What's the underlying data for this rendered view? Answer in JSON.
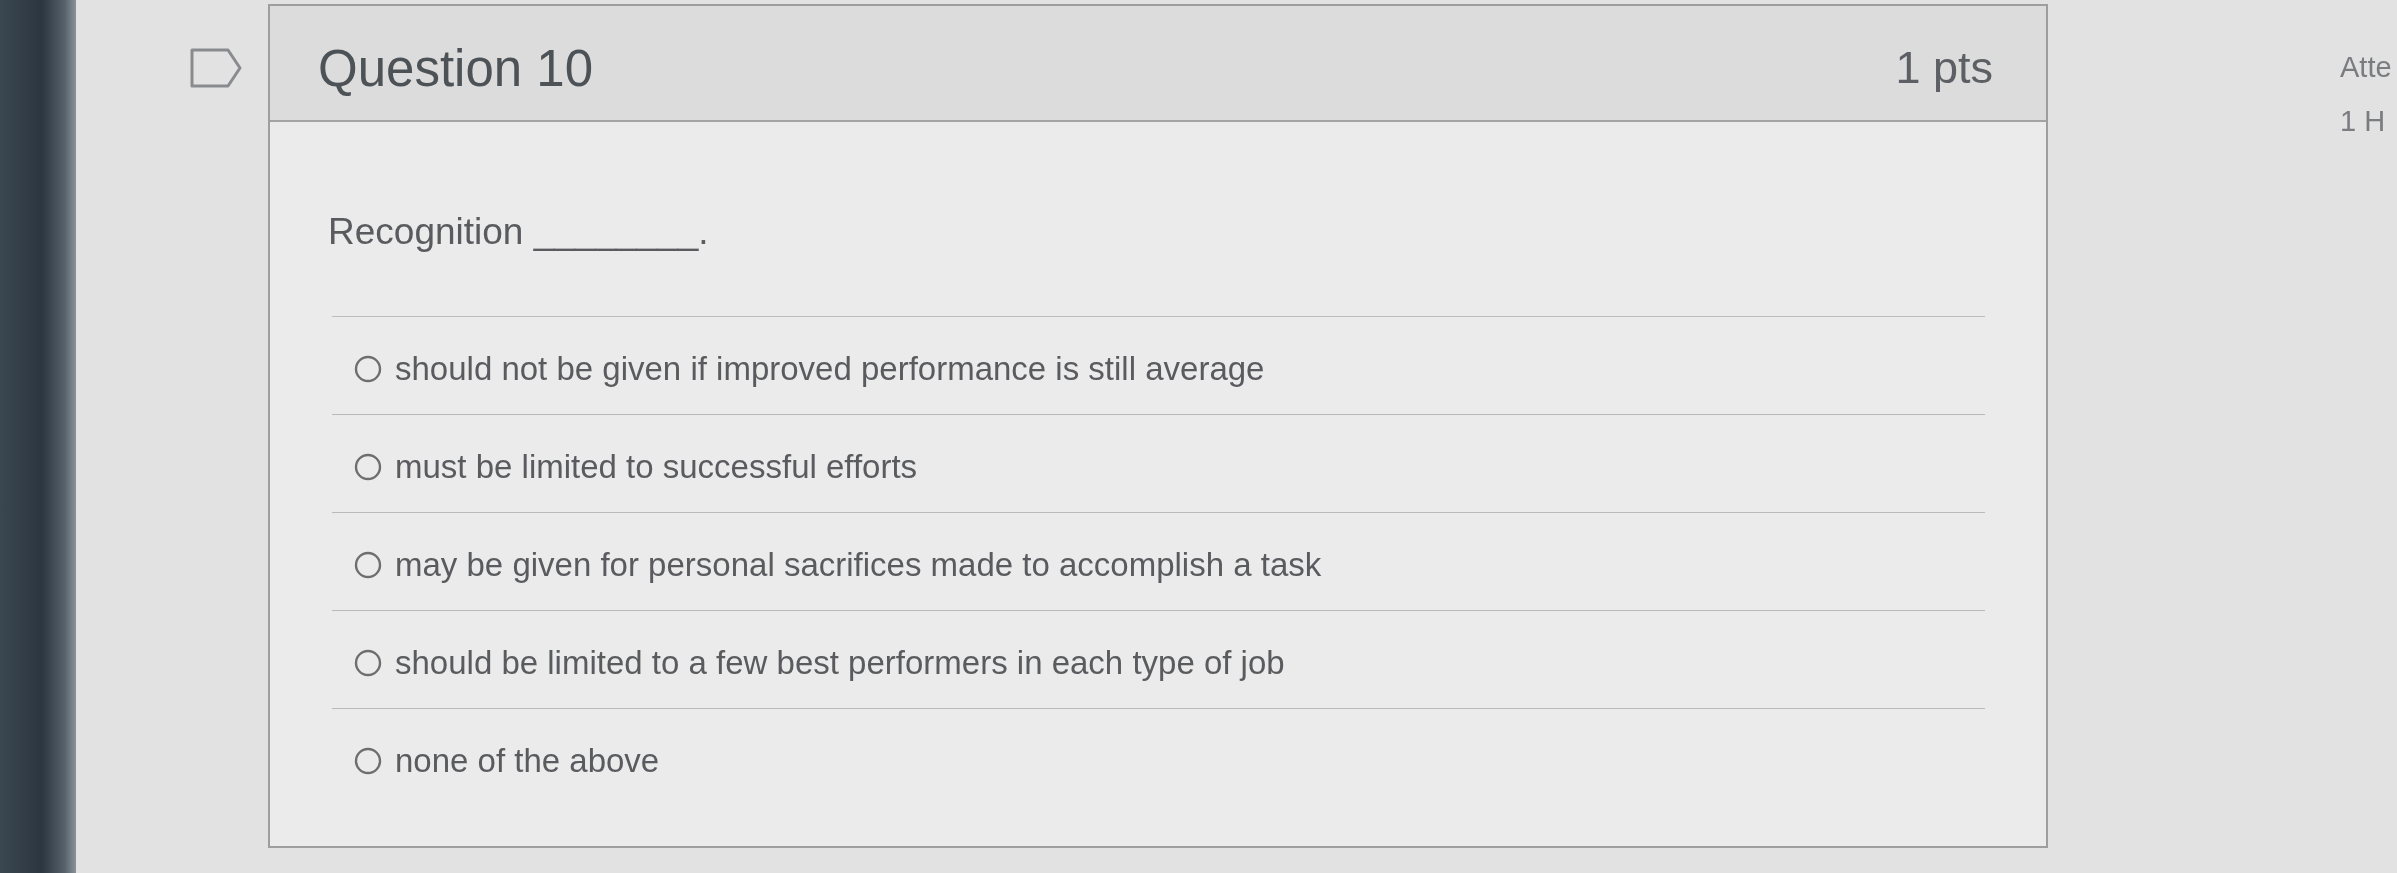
{
  "question": {
    "title": "Question 10",
    "points": "1 pts",
    "prompt": "Recognition ________.",
    "options": [
      {
        "label": "should not be given if improved performance is still average",
        "selected": false
      },
      {
        "label": "must be limited to successful efforts",
        "selected": false
      },
      {
        "label": "may be given for personal sacrifices made to accomplish a task",
        "selected": false
      },
      {
        "label": "should be limited to a few best performers in each type of job",
        "selected": false
      },
      {
        "label": "none of the above",
        "selected": false
      }
    ]
  },
  "side_panel": {
    "lines": [
      "Atte",
      "1 H"
    ]
  }
}
